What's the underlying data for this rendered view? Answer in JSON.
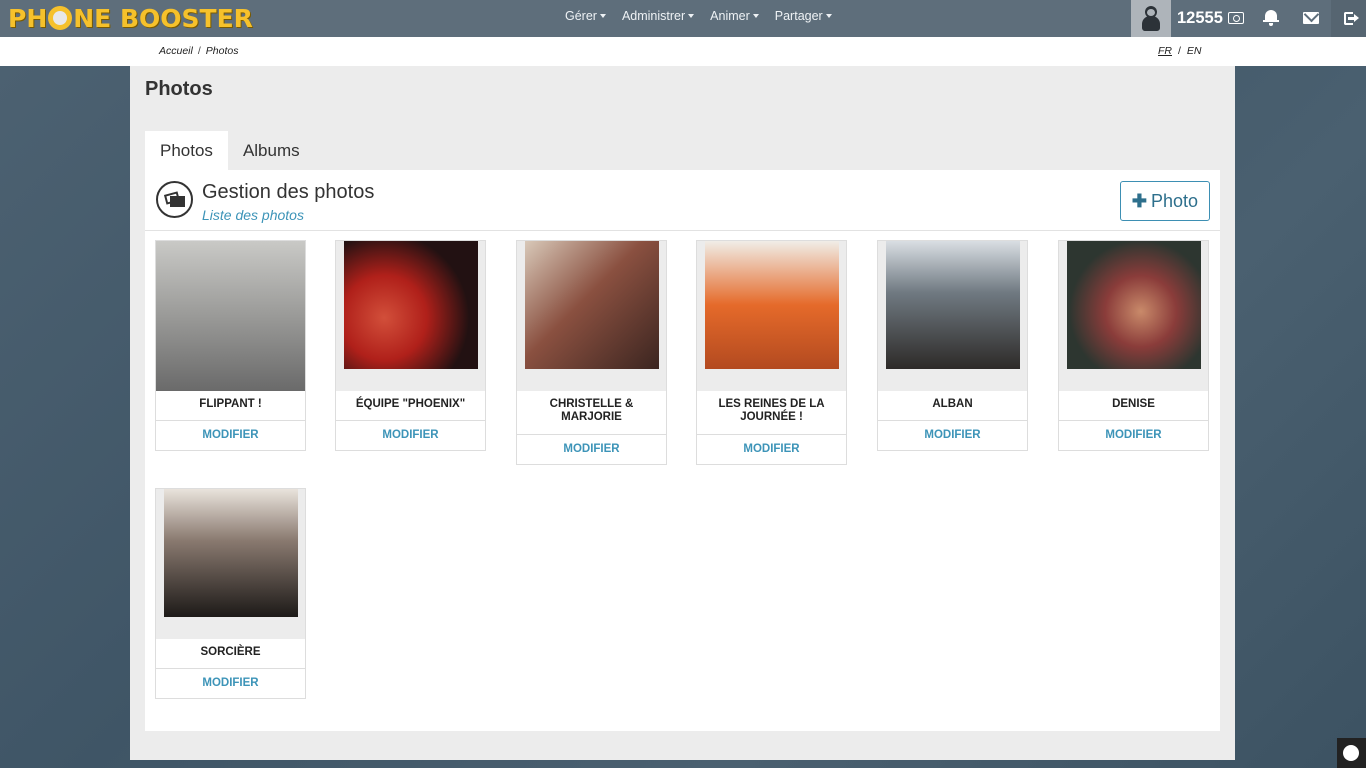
{
  "brand": {
    "logo_text_left": "PH",
    "logo_text_right": "NE BOOSTER"
  },
  "nav": {
    "items": [
      "Gérer",
      "Administrer",
      "Animer",
      "Partager"
    ]
  },
  "user": {
    "points": "12555",
    "avatar_icon": "user-avatar-icon"
  },
  "icons": {
    "money": "money-icon",
    "bell": "bell-icon",
    "mail": "envelope-icon",
    "logout": "logout-icon"
  },
  "breadcrumb": {
    "home": "Accueil",
    "separator": "/",
    "current": "Photos"
  },
  "language": {
    "fr": "FR",
    "separator": "/",
    "en": "EN"
  },
  "page": {
    "title": "Photos"
  },
  "tabs": [
    {
      "label": "Photos"
    },
    {
      "label": "Albums"
    }
  ],
  "section": {
    "title": "Gestion des photos",
    "subtitle": "Liste des photos",
    "add_button": "Photo"
  },
  "photos": [
    {
      "caption": "FLIPPANT !",
      "action": "MODIFIER"
    },
    {
      "caption": "ÉQUIPE \"PHOENIX\"",
      "action": "MODIFIER"
    },
    {
      "caption": "CHRISTELLE & MARJORIE",
      "action": "MODIFIER"
    },
    {
      "caption": "LES REINES DE LA JOURNÉE !",
      "action": "MODIFIER"
    },
    {
      "caption": "ALBAN",
      "action": "MODIFIER"
    },
    {
      "caption": "DENISE",
      "action": "MODIFIER"
    },
    {
      "caption": "SORCIÈRE",
      "action": "MODIFIER"
    }
  ],
  "colors": {
    "navbar": "#5e6e7b",
    "logo": "#f6c12b",
    "link": "#3d94b8",
    "panel": "#ececec"
  }
}
